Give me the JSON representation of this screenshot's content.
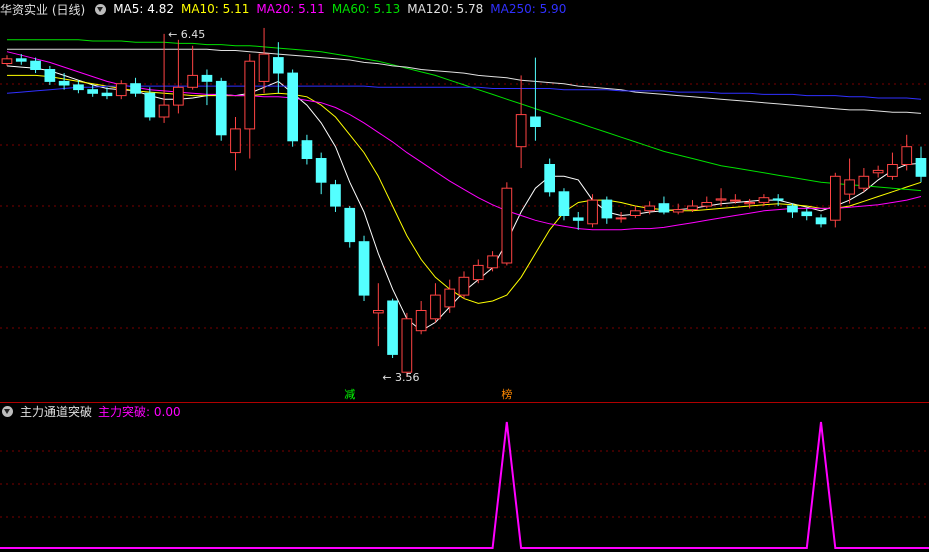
{
  "header": {
    "title": "华资实业 (日线)",
    "ma": [
      {
        "label": "MA5: 4.82",
        "color": "#ffffff"
      },
      {
        "label": "MA10: 5.11",
        "color": "#ffff00"
      },
      {
        "label": "MA20: 5.11",
        "color": "#ff00ff"
      },
      {
        "label": "MA60: 5.13",
        "color": "#00e000"
      },
      {
        "label": "MA120: 5.78",
        "color": "#e0e0e0"
      },
      {
        "label": "MA250: 5.90",
        "color": "#3030ff"
      }
    ]
  },
  "indicator": {
    "title": "主力通道突破",
    "value_label": "主力突破: 0.00",
    "value_color": "#ff00ff"
  },
  "colors": {
    "up": "#ff4444",
    "down": "#54ffff",
    "grid": "#7a0000"
  },
  "chart_data": [
    {
      "type": "candlestick",
      "y_range": [
        3.4,
        6.55
      ],
      "annotations": [
        {
          "text": "6.45",
          "at_candle": 11,
          "value": 6.45
        },
        {
          "text": "3.56",
          "at_candle": 26,
          "value": 3.56
        },
        {
          "text": "减",
          "at_candle": 24,
          "color": "#00ff00"
        },
        {
          "text": "榜",
          "at_candle": 35,
          "color": "#ff8800"
        }
      ],
      "candles": [
        [
          6.2,
          6.24,
          6.27,
          6.18
        ],
        [
          6.24,
          6.22,
          6.28,
          6.19
        ],
        [
          6.22,
          6.15,
          6.25,
          6.12
        ],
        [
          6.15,
          6.05,
          6.18,
          6.02
        ],
        [
          6.05,
          6.02,
          6.12,
          5.98
        ],
        [
          6.02,
          5.98,
          6.06,
          5.95
        ],
        [
          5.98,
          5.95,
          6.02,
          5.92
        ],
        [
          5.95,
          5.93,
          6.0,
          5.9
        ],
        [
          5.93,
          6.03,
          6.06,
          5.9
        ],
        [
          6.03,
          5.95,
          6.08,
          5.92
        ],
        [
          5.95,
          5.75,
          6.0,
          5.72
        ],
        [
          5.75,
          5.85,
          6.45,
          5.7
        ],
        [
          5.85,
          6.0,
          6.4,
          5.78
        ],
        [
          6.0,
          6.1,
          6.35,
          5.98
        ],
        [
          6.1,
          6.05,
          6.15,
          5.85
        ],
        [
          6.05,
          5.6,
          6.08,
          5.55
        ],
        [
          5.45,
          5.65,
          5.75,
          5.3
        ],
        [
          5.65,
          6.22,
          6.28,
          5.4
        ],
        [
          6.05,
          6.28,
          6.5,
          5.95
        ],
        [
          6.25,
          6.12,
          6.38,
          5.95
        ],
        [
          6.12,
          5.55,
          6.15,
          5.5
        ],
        [
          5.55,
          5.4,
          5.6,
          5.35
        ],
        [
          5.4,
          5.2,
          5.45,
          5.1
        ],
        [
          5.18,
          5.0,
          5.22,
          4.95
        ],
        [
          4.98,
          4.7,
          5.0,
          4.65
        ],
        [
          4.7,
          4.25,
          4.75,
          4.2
        ],
        [
          4.1,
          4.12,
          4.35,
          3.82
        ],
        [
          4.2,
          3.75,
          4.22,
          3.72
        ],
        [
          3.6,
          4.05,
          4.1,
          3.56
        ],
        [
          3.95,
          4.12,
          4.2,
          3.92
        ],
        [
          4.05,
          4.25,
          4.35,
          4.02
        ],
        [
          4.15,
          4.3,
          4.38,
          4.1
        ],
        [
          4.25,
          4.4,
          4.45,
          4.22
        ],
        [
          4.38,
          4.5,
          4.55,
          4.35
        ],
        [
          4.48,
          4.58,
          4.62,
          4.45
        ],
        [
          4.52,
          5.15,
          5.2,
          4.5
        ],
        [
          5.5,
          5.77,
          6.1,
          5.32
        ],
        [
          5.75,
          5.67,
          6.25,
          5.55
        ],
        [
          5.35,
          5.12,
          5.4,
          5.08
        ],
        [
          5.12,
          4.92,
          5.15,
          4.88
        ],
        [
          4.9,
          4.88,
          4.95,
          4.8
        ],
        [
          4.85,
          5.05,
          5.1,
          4.82
        ],
        [
          5.05,
          4.9,
          5.08,
          4.85
        ],
        [
          4.9,
          4.9,
          4.95,
          4.86
        ],
        [
          4.92,
          4.96,
          5.0,
          4.9
        ],
        [
          4.96,
          5.0,
          5.04,
          4.93
        ],
        [
          5.02,
          4.95,
          5.08,
          4.93
        ],
        [
          4.95,
          4.97,
          5.02,
          4.93
        ],
        [
          4.97,
          5.0,
          5.05,
          4.95
        ],
        [
          5.0,
          5.03,
          5.08,
          4.98
        ],
        [
          5.05,
          5.06,
          5.15,
          5.0
        ],
        [
          5.05,
          5.05,
          5.1,
          5.02
        ],
        [
          5.02,
          5.03,
          5.06,
          4.98
        ],
        [
          5.03,
          5.07,
          5.1,
          5.0
        ],
        [
          5.06,
          5.05,
          5.1,
          5.0
        ],
        [
          5.0,
          4.95,
          5.02,
          4.9
        ],
        [
          4.95,
          4.92,
          4.98,
          4.88
        ],
        [
          4.9,
          4.85,
          4.93,
          4.82
        ],
        [
          4.88,
          5.25,
          5.28,
          4.82
        ],
        [
          5.1,
          5.22,
          5.4,
          5.02
        ],
        [
          5.15,
          5.25,
          5.32,
          5.12
        ],
        [
          5.28,
          5.3,
          5.34,
          5.24
        ],
        [
          5.25,
          5.35,
          5.45,
          5.22
        ],
        [
          5.35,
          5.5,
          5.6,
          5.3
        ],
        [
          5.4,
          5.25,
          5.5,
          5.2
        ]
      ],
      "series": [
        {
          "name": "MA5",
          "color": "#ffffff",
          "values": [
            6.18,
            6.17,
            6.16,
            6.14,
            6.1,
            6.06,
            6.02,
            5.99,
            5.98,
            5.97,
            5.93,
            5.9,
            5.9,
            5.91,
            5.93,
            5.94,
            5.93,
            5.95,
            6.0,
            6.05,
            5.95,
            5.85,
            5.7,
            5.5,
            5.2,
            4.95,
            4.6,
            4.3,
            4.05,
            3.95,
            4.02,
            4.15,
            4.28,
            4.38,
            4.48,
            4.7,
            4.95,
            5.15,
            5.25,
            5.25,
            5.22,
            5.05,
            4.95,
            4.92,
            4.93,
            4.95,
            4.96,
            4.97,
            4.98,
            5.0,
            5.02,
            5.03,
            5.04,
            5.05,
            5.05,
            5.02,
            4.99,
            4.96,
            5.0,
            5.05,
            5.12,
            5.22,
            5.3,
            5.35,
            5.36
          ]
        },
        {
          "name": "MA10",
          "color": "#ffff00",
          "values": [
            6.1,
            6.1,
            6.1,
            6.09,
            6.07,
            6.05,
            6.03,
            6.01,
            5.99,
            5.97,
            5.96,
            5.95,
            5.94,
            5.93,
            5.93,
            5.93,
            5.93,
            5.93,
            5.94,
            5.95,
            5.94,
            5.92,
            5.85,
            5.75,
            5.6,
            5.45,
            5.25,
            5.0,
            4.75,
            4.55,
            4.4,
            4.3,
            4.22,
            4.18,
            4.2,
            4.25,
            4.4,
            4.6,
            4.8,
            4.95,
            5.03,
            5.05,
            5.05,
            5.03,
            5.0,
            4.98,
            4.97,
            4.96,
            4.96,
            4.97,
            4.98,
            4.99,
            5.0,
            5.01,
            5.02,
            5.01,
            5.0,
            4.98,
            4.98,
            5.0,
            5.04,
            5.08,
            5.12,
            5.16,
            5.2
          ]
        },
        {
          "name": "MA20",
          "color": "#ff00ff",
          "values": [
            6.3,
            6.27,
            6.24,
            6.21,
            6.17,
            6.13,
            6.09,
            6.05,
            6.02,
            6.0,
            5.98,
            5.97,
            5.96,
            5.95,
            5.94,
            5.94,
            5.93,
            5.93,
            5.92,
            5.92,
            5.91,
            5.89,
            5.87,
            5.83,
            5.77,
            5.7,
            5.62,
            5.54,
            5.45,
            5.37,
            5.29,
            5.21,
            5.14,
            5.07,
            5.01,
            4.96,
            4.92,
            4.88,
            4.85,
            4.83,
            4.81,
            4.8,
            4.8,
            4.8,
            4.81,
            4.81,
            4.82,
            4.84,
            4.86,
            4.88,
            4.9,
            4.92,
            4.94,
            4.96,
            4.97,
            4.98,
            4.98,
            4.98,
            4.98,
            4.99,
            5.0,
            5.01,
            5.03,
            5.05,
            5.08
          ]
        },
        {
          "name": "MA60",
          "color": "#00e000",
          "values": [
            6.4,
            6.4,
            6.4,
            6.4,
            6.4,
            6.4,
            6.39,
            6.39,
            6.39,
            6.38,
            6.38,
            6.38,
            6.37,
            6.37,
            6.36,
            6.36,
            6.35,
            6.35,
            6.34,
            6.33,
            6.32,
            6.31,
            6.3,
            6.28,
            6.26,
            6.24,
            6.22,
            6.19,
            6.16,
            6.13,
            6.1,
            6.06,
            6.02,
            5.98,
            5.94,
            5.9,
            5.86,
            5.82,
            5.78,
            5.74,
            5.7,
            5.66,
            5.62,
            5.58,
            5.54,
            5.5,
            5.46,
            5.43,
            5.4,
            5.37,
            5.34,
            5.32,
            5.3,
            5.28,
            5.26,
            5.24,
            5.22,
            5.2,
            5.19,
            5.18,
            5.17,
            5.16,
            5.15,
            5.14,
            5.13
          ]
        },
        {
          "name": "MA120",
          "color": "#e0e0e0",
          "values": [
            6.32,
            6.32,
            6.32,
            6.32,
            6.32,
            6.32,
            6.32,
            6.32,
            6.32,
            6.32,
            6.32,
            6.32,
            6.32,
            6.32,
            6.32,
            6.31,
            6.31,
            6.3,
            6.29,
            6.28,
            6.27,
            6.26,
            6.25,
            6.24,
            6.23,
            6.21,
            6.2,
            6.18,
            6.17,
            6.15,
            6.14,
            6.13,
            6.12,
            6.1,
            6.09,
            6.08,
            6.06,
            6.05,
            6.04,
            6.03,
            6.01,
            6.0,
            5.99,
            5.98,
            5.96,
            5.95,
            5.94,
            5.93,
            5.92,
            5.91,
            5.9,
            5.89,
            5.88,
            5.87,
            5.86,
            5.85,
            5.84,
            5.83,
            5.82,
            5.81,
            5.81,
            5.8,
            5.79,
            5.79,
            5.78
          ]
        },
        {
          "name": "MA250",
          "color": "#3030ff",
          "values": [
            5.95,
            5.96,
            5.97,
            5.98,
            5.99,
            6.0,
            6.0,
            6.01,
            6.01,
            6.01,
            6.01,
            6.01,
            6.01,
            6.01,
            6.01,
            6.01,
            6.01,
            6.01,
            6.01,
            6.01,
            6.01,
            6.01,
            6.01,
            6.01,
            6.01,
            6.01,
            6.0,
            6.0,
            6.0,
            6.0,
            6.0,
            6.0,
            6.0,
            6.0,
            5.99,
            5.99,
            5.99,
            5.99,
            5.99,
            5.98,
            5.98,
            5.98,
            5.98,
            5.97,
            5.97,
            5.97,
            5.97,
            5.96,
            5.96,
            5.96,
            5.95,
            5.95,
            5.95,
            5.94,
            5.94,
            5.94,
            5.93,
            5.93,
            5.93,
            5.92,
            5.92,
            5.91,
            5.91,
            5.91,
            5.9
          ]
        }
      ]
    },
    {
      "type": "line",
      "name": "主力突破",
      "color": "#ff00ff",
      "y_range": [
        0,
        1
      ],
      "values": [
        0,
        0,
        0,
        0,
        0,
        0,
        0,
        0,
        0,
        0,
        0,
        0,
        0,
        0,
        0,
        0,
        0,
        0,
        0,
        0,
        0,
        0,
        0,
        0,
        0,
        0,
        0,
        0,
        0,
        0,
        0,
        0,
        0,
        0,
        0,
        1,
        0,
        0,
        0,
        0,
        0,
        0,
        0,
        0,
        0,
        0,
        0,
        0,
        0,
        0,
        0,
        0,
        0,
        0,
        0,
        0,
        0,
        1,
        0,
        0,
        0,
        0,
        0,
        0,
        0
      ]
    }
  ]
}
